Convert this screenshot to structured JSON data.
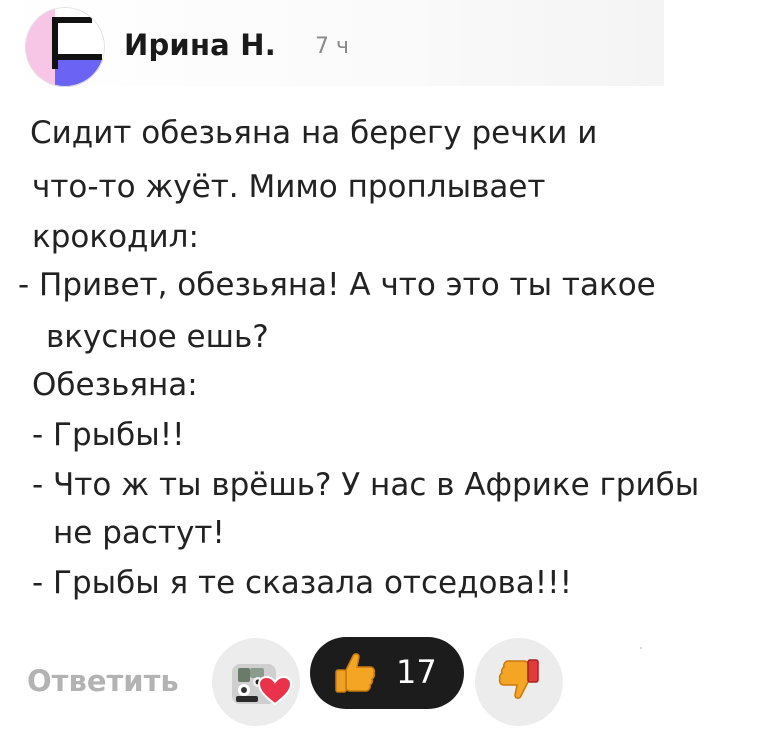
{
  "comment": {
    "author": "Ирина Н.",
    "time": "7 ч",
    "lines": [
      "Сидит обезьяна на берегу речки и",
      "что-то жуёт. Мимо проплывает",
      "крокодил:",
      "- Привет, обезьяна! А что это ты такое",
      "вкусное ешь?",
      "Обезьяна:",
      "- Грыбы!!",
      "- Что ж ты врёшь? У нас в Африке грибы",
      "не растут!",
      "- Грыбы я те сказала отседова!!!"
    ]
  },
  "actions": {
    "reply_label": "Ответить",
    "like_count": "17"
  },
  "icons": {
    "avatar": "avatar",
    "reactions": "reactions-icon",
    "like": "thumbs-up-icon",
    "dislike": "thumbs-down-icon",
    "heart": "heart-icon"
  },
  "colors": {
    "avatar_pink": "#f7c6e6",
    "avatar_purple": "#6b63f3",
    "like_bg": "#1c1c1c",
    "thumb_yellow": "#f5a524",
    "heart_red": "#e8334a"
  }
}
